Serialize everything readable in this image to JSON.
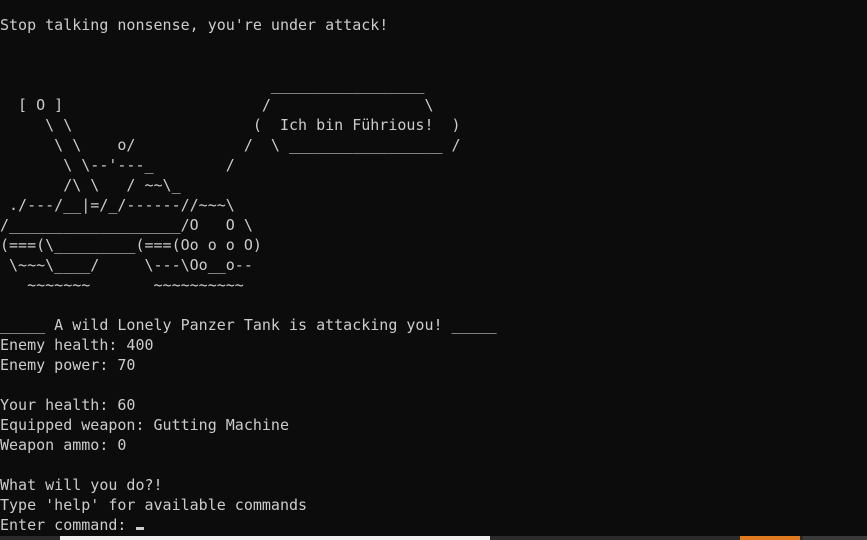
{
  "console": {
    "message": "Stop talking nonsense, you're under attack!",
    "ascii_art": [
      "                              _________________",
      "  [ O ]                      /                 \\",
      "     \\ \\                    (  Ich bin Führious!  )",
      "      \\ \\    o/            /  \\ _________________ /",
      "       \\ \\--'---_        /",
      "       /\\ \\   / ~~\\_",
      " ./---/__|=/_/------//~~~\\",
      "/___________________/O   O \\",
      "(===(\\_________(===(Oo o o O)",
      " \\~~~\\____/     \\---\\Oo__o--",
      "   ~~~~~~~       ~~~~~~~~~~"
    ],
    "encounter_header": "_____ A wild Lonely Panzer Tank is attacking you! _____",
    "enemy_health_label": "Enemy health: 400",
    "enemy_power_label": "Enemy power: 70",
    "your_health_label": "Your health: 60",
    "equipped_weapon_label": "Equipped weapon: Gutting Machine",
    "weapon_ammo_label": "Weapon ammo: 0",
    "prompt_question": "What will you do?!",
    "help_hint": "Type 'help' for available commands",
    "command_prompt": "Enter command: "
  },
  "colors": {
    "background": "#0c0c0c",
    "text": "#cccccc"
  }
}
